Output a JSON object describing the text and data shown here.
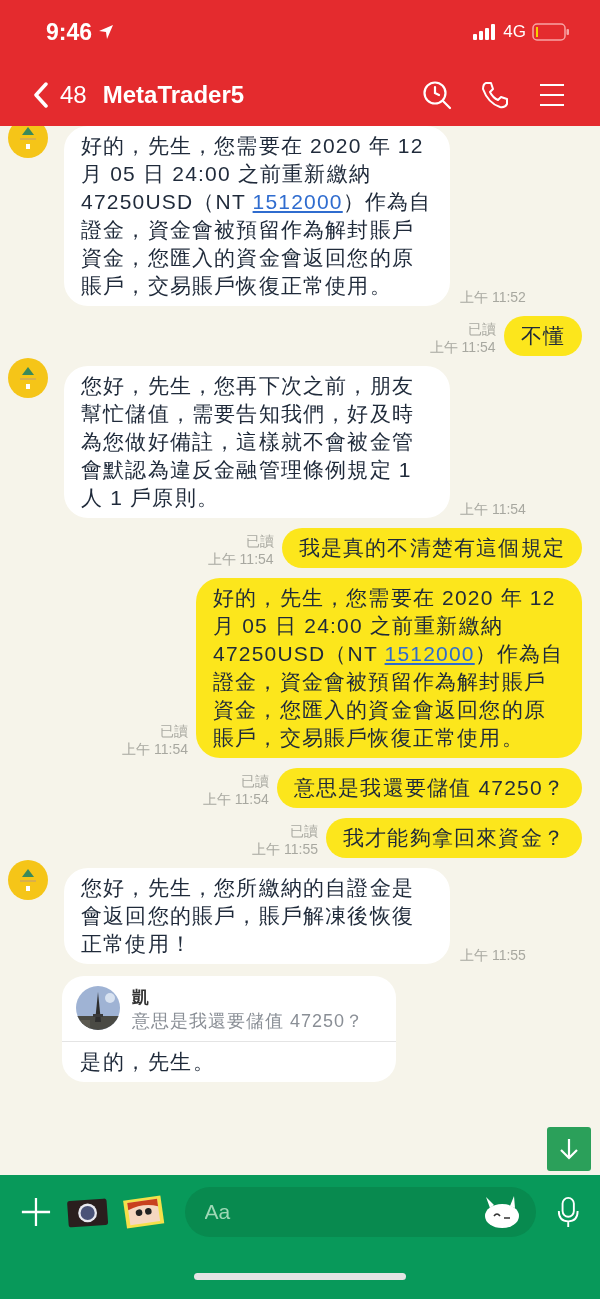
{
  "status_bar": {
    "time": "9:46",
    "network": "4G"
  },
  "header": {
    "back_count": "48",
    "title": "MetaTrader5"
  },
  "messages": [
    {
      "kind": "received",
      "parts": [
        {
          "text": "好的，先生，您需要在 2020 年 12 月 05 日 24:00 之前重新繳納 47250USD（NT "
        },
        {
          "text": "1512000",
          "link": true
        },
        {
          "text": "）作為自證金，資金會被預留作為解封賬戶資金，您匯入的資金會返回您的原賬戶，交易賬戶恢復正常使用。"
        }
      ],
      "time": "上午 11:52"
    },
    {
      "kind": "sent",
      "parts": [
        {
          "text": "不懂"
        }
      ],
      "read": "已讀",
      "time": "上午 11:54"
    },
    {
      "kind": "received",
      "parts": [
        {
          "text": "您好，先生，您再下次之前，朋友幫忙儲值，需要告知我們，好及時為您做好備註，這樣就不會被金管會默認為違反金融管理條例規定 1 人 1 戶原則。"
        }
      ],
      "time": "上午 11:54"
    },
    {
      "kind": "sent",
      "parts": [
        {
          "text": "我是真的不清楚有這個規定"
        }
      ],
      "read": "已讀",
      "time": "上午 11:54"
    },
    {
      "kind": "sent",
      "parts": [
        {
          "text": "好的，先生，您需要在 2020 年 12 月 05 日 24:00 之前重新繳納 47250USD（NT "
        },
        {
          "text": "1512000",
          "link": true
        },
        {
          "text": "）作為自證金，資金會被預留作為解封賬戶資金，您匯入的資金會返回您的原賬戶，交易賬戶恢復正常使用。"
        }
      ],
      "read": "已讀",
      "time": "上午 11:54"
    },
    {
      "kind": "sent",
      "parts": [
        {
          "text": "意思是我還要儲值 47250？"
        }
      ],
      "read": "已讀",
      "time": "上午 11:54"
    },
    {
      "kind": "sent",
      "parts": [
        {
          "text": "我才能夠拿回來資金？"
        }
      ],
      "read": "已讀",
      "time": "上午 11:55"
    },
    {
      "kind": "received",
      "parts": [
        {
          "text": "您好，先生，您所繳納的自證金是會返回您的賬戶，賬戶解凍後恢復正常使用！"
        }
      ],
      "time": "上午 11:55"
    },
    {
      "kind": "reply",
      "quote_name": "凱",
      "quote_text": "意思是我還要儲值 47250？",
      "parts": [
        {
          "text": "是的，先生。"
        }
      ]
    }
  ],
  "composer": {
    "placeholder": "Aa"
  }
}
